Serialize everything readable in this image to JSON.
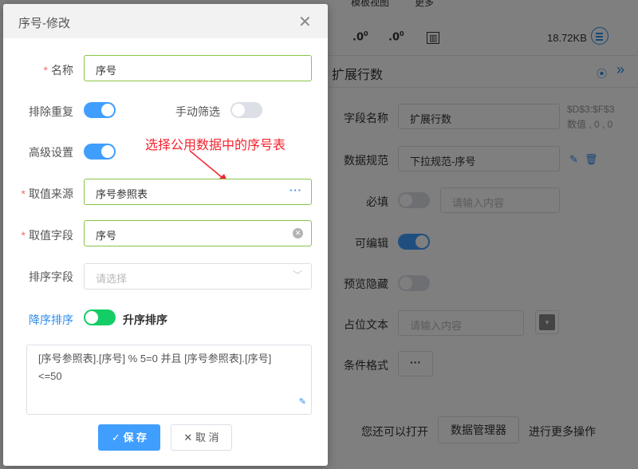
{
  "top_tabs": [
    "模板视图",
    "更多"
  ],
  "toolbar": {
    "file_size": "18.72KB",
    "icons": [
      "decimal-increase-icon",
      "decimal-decrease-icon",
      "format-icon",
      "list-icon"
    ]
  },
  "panel": {
    "title": "扩展行数",
    "props": {
      "field_name_label": "字段名称",
      "field_name_value": "扩展行数",
      "coord_line1": "$D$3:$F$3",
      "coord_line2": "数值 , 0 , 0",
      "data_spec_label": "数据规范",
      "data_spec_value": "下拉规范-序号",
      "required_label": "必填",
      "required_placeholder": "请输入内容",
      "editable_label": "可编辑",
      "preview_hidden_label": "预览隐藏",
      "placeholder_label": "占位文本",
      "placeholder_placeholder": "请输入内容",
      "cond_format_label": "条件格式",
      "cond_format_button": "···"
    },
    "hint_prefix": "您还可以打开",
    "data_manager_button": "数据管理器",
    "hint_suffix": "进行更多操作"
  },
  "dialog": {
    "title": "序号-修改",
    "name_label": "名称",
    "name_value": "序号",
    "dedupe_label": "排除重复",
    "dedupe_on": true,
    "manual_filter_label": "手动筛选",
    "manual_filter_on": false,
    "advanced_label": "高级设置",
    "advanced_on": true,
    "annotation": "选择公用数据中的序号表",
    "source_label": "取值来源",
    "source_value": "序号参照表",
    "source_more": "···",
    "field_label": "取值字段",
    "field_value": "序号",
    "sort_field_label": "排序字段",
    "sort_field_placeholder": "请选择",
    "sort_desc": "降序排序",
    "sort_asc": "升序排序",
    "formula_line1": "[序号参照表].[序号] % 5=0 并且 [序号参照表].[序号]",
    "formula_line2": "<=50",
    "save_button": "保 存",
    "cancel_button": "取 消"
  },
  "colors": {
    "accent": "#409eff",
    "required": "#f56c6c",
    "annotation": "#f5222d",
    "switch_green": "#13ce66"
  }
}
